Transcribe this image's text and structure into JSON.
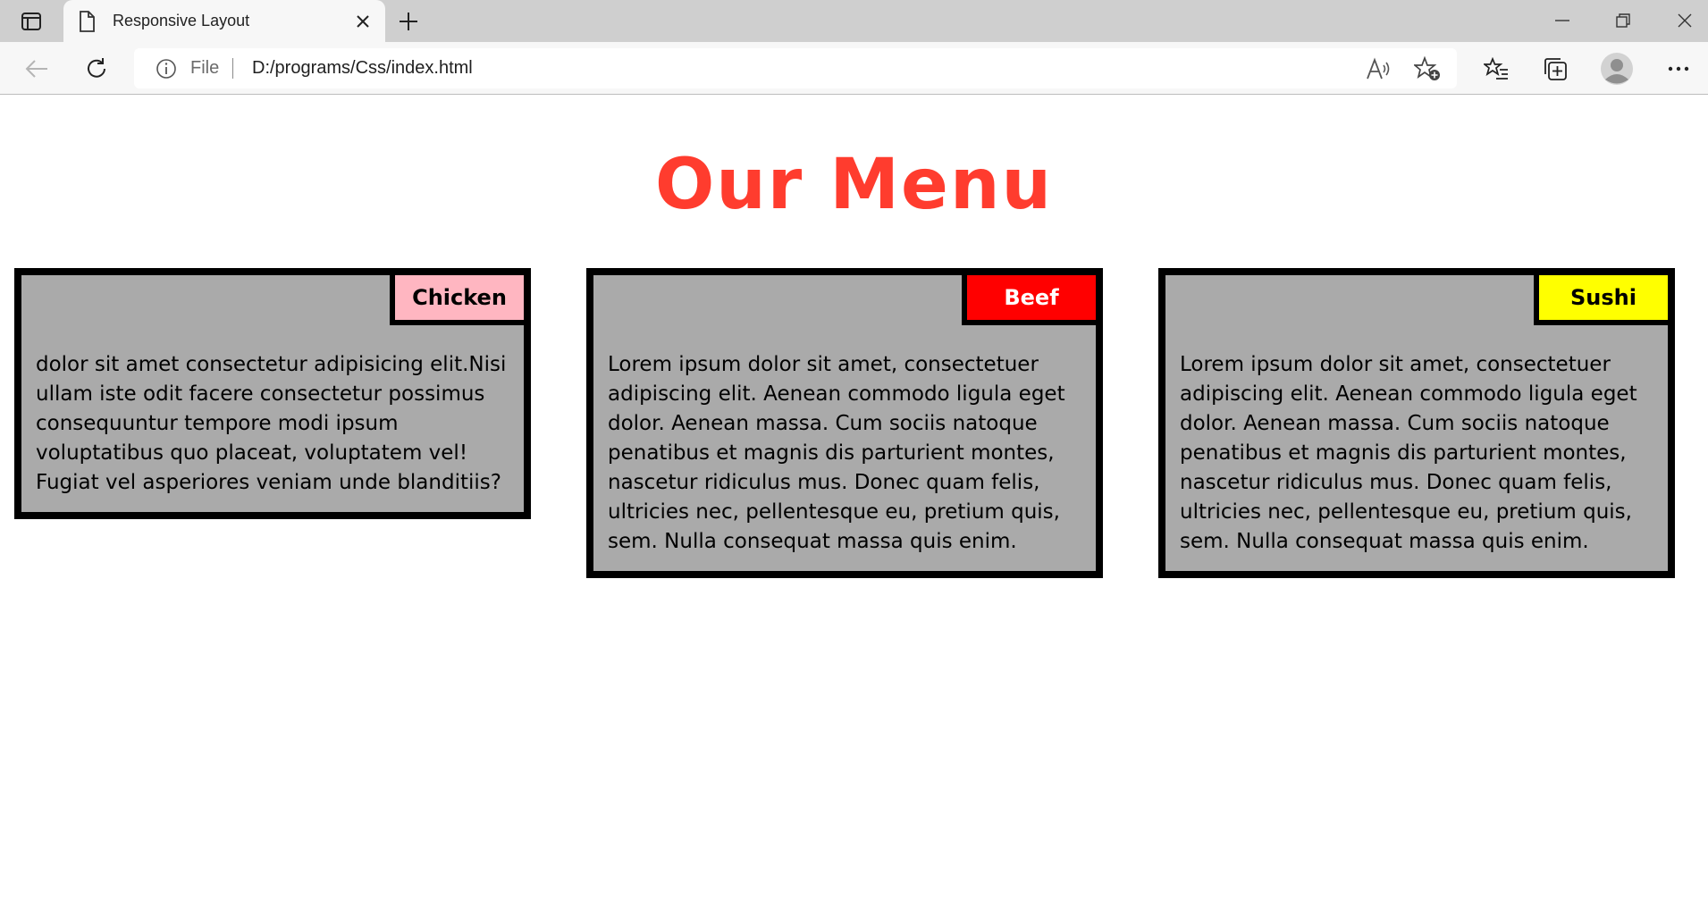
{
  "browser": {
    "tab": {
      "title": "Responsive Layout"
    },
    "address": {
      "scheme_label": "File",
      "url": "D:/programs/Css/index.html"
    },
    "icons": {
      "tab_actions": "tab-actions-icon",
      "page": "page-icon",
      "close": "close-icon",
      "new_tab": "plus-icon",
      "back": "back-arrow-icon",
      "reload": "reload-icon",
      "info": "info-icon",
      "read_aloud": "read-aloud-icon",
      "add_favorite": "star-plus-icon",
      "favorites": "favorites-icon",
      "collections": "collections-icon",
      "profile": "profile-avatar-icon",
      "more": "more-icon"
    }
  },
  "page": {
    "heading": "Our Menu",
    "heading_color": "#ff3c2e",
    "card_background": "#aaaaaa",
    "cards": [
      {
        "tag": "Chicken",
        "tag_color": "#ffb6c1",
        "tag_text_color": "#000000",
        "text": "dolor sit amet consectetur adipisicing elit.Nisi ullam iste odit facere consectetur possimus consequuntur tempore modi ipsum voluptatibus quo placeat, voluptatem vel! Fugiat vel asperiores veniam unde blanditiis?"
      },
      {
        "tag": "Beef",
        "tag_color": "#ff0000",
        "tag_text_color": "#ffffff",
        "text": "Lorem ipsum dolor sit amet, consectetuer adipiscing elit. Aenean commodo ligula eget dolor. Aenean massa. Cum sociis natoque penatibus et magnis dis parturient montes, nascetur ridiculus mus. Donec quam felis, ultricies nec, pellentesque eu, pretium quis, sem. Nulla consequat massa quis enim."
      },
      {
        "tag": "Sushi",
        "tag_color": "#ffff00",
        "tag_text_color": "#000000",
        "text": "Lorem ipsum dolor sit amet, consectetuer adipiscing elit. Aenean commodo ligula eget dolor. Aenean massa. Cum sociis natoque penatibus et magnis dis parturient montes, nascetur ridiculus mus. Donec quam felis, ultricies nec, pellentesque eu, pretium quis, sem. Nulla consequat massa quis enim."
      }
    ]
  }
}
